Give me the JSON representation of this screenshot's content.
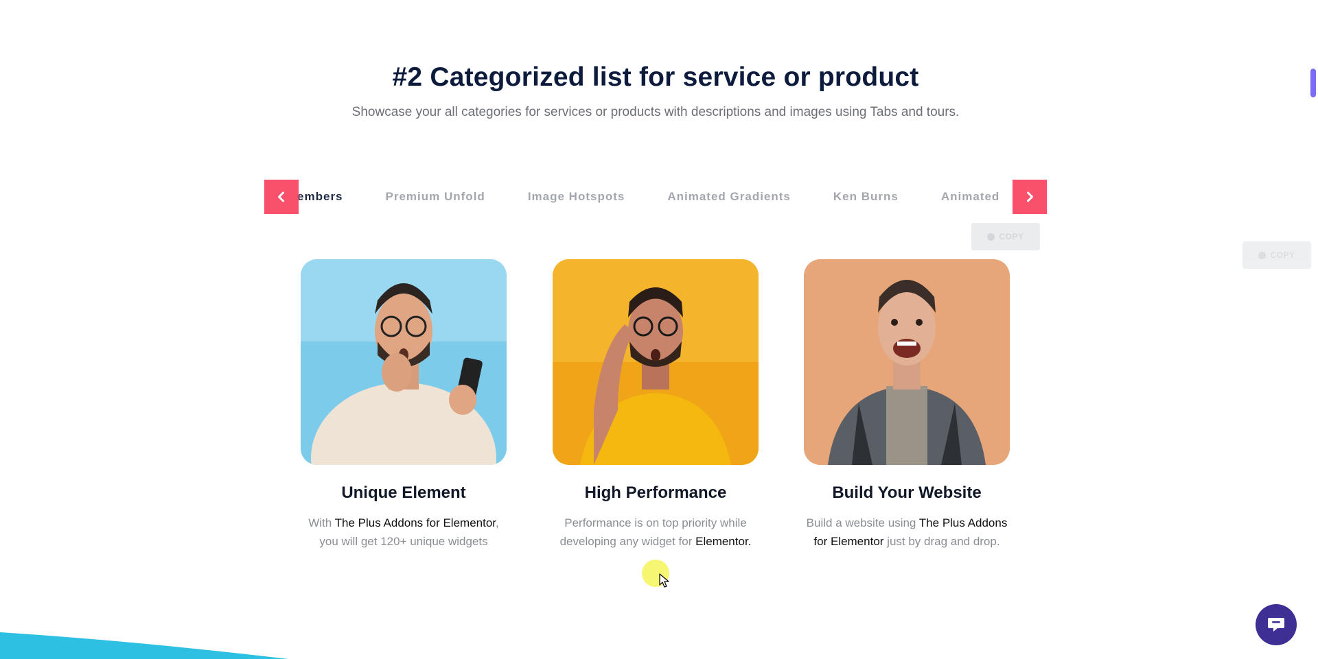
{
  "section": {
    "heading": "#2 Categorized list for service or product",
    "subheading": "Showcase your all categories for services or products with descriptions and images using Tabs and tours."
  },
  "tabs": [
    {
      "label": "Team Members",
      "active": true
    },
    {
      "label": "Premium Unfold",
      "active": false
    },
    {
      "label": "Image Hotspots",
      "active": false
    },
    {
      "label": "Animated Gradients",
      "active": false
    },
    {
      "label": "Ken Burns",
      "active": false
    },
    {
      "label": "Animated",
      "active": false
    }
  ],
  "copy_label": "COPY",
  "cards": [
    {
      "title": "Unique Element",
      "desc_before": "With ",
      "desc_strong": "The Plus Addons for Elementor",
      "desc_after": ", you will get 120+ unique widgets",
      "bg_color": "#7ccbeb"
    },
    {
      "title": "High Performance",
      "desc_before": "Performance is on top priority while developing any widget for ",
      "desc_strong": "Elementor.",
      "desc_after": "",
      "bg_color": "#f0a418"
    },
    {
      "title": "Build Your Website",
      "desc_before": "Build a website using ",
      "desc_strong": "The Plus Addons for Elementor",
      "desc_after": " just by drag and drop.",
      "bg_color": "#e7a679"
    }
  ],
  "colors": {
    "accent": "#f9516b",
    "heading": "#0d1b3d",
    "chat": "#3e2f94",
    "wave": "#2ec0e3",
    "scrollbar": "#7b6cf6"
  },
  "icons": {
    "prev": "chevron-left-icon",
    "next": "chevron-right-icon",
    "chat": "chat-icon",
    "cursor": "cursor-arrow-icon"
  }
}
